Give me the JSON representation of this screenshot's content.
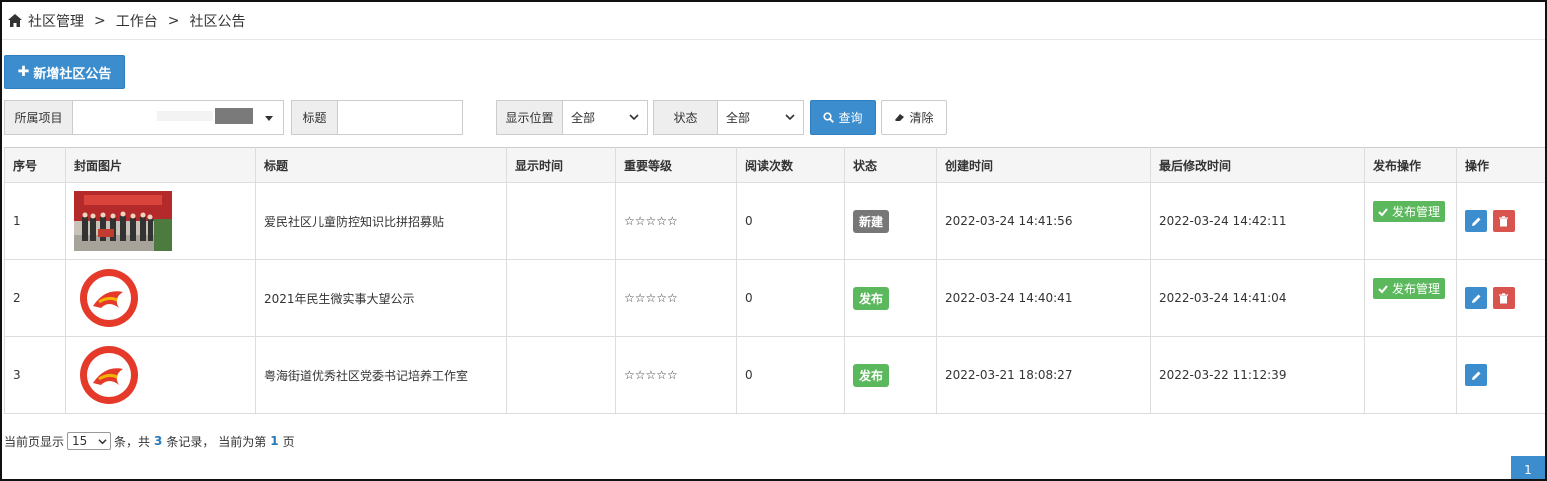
{
  "breadcrumb": {
    "items": [
      "社区管理",
      "工作台",
      "社区公告"
    ],
    "separator": ">"
  },
  "toolbar": {
    "add_label": "新增社区公告"
  },
  "filters": {
    "project_label": "所属项目",
    "title_label": "标题",
    "title_value": "",
    "display_label": "显示位置",
    "display_value": "全部",
    "status_label": "状态",
    "status_value": "全部",
    "query_label": "查询",
    "clear_label": "清除"
  },
  "table": {
    "headers": [
      "序号",
      "封面图片",
      "标题",
      "显示时间",
      "重要等级",
      "阅读次数",
      "状态",
      "创建时间",
      "最后修改时间",
      "发布操作",
      "操作"
    ],
    "rows": [
      {
        "index": "1",
        "cover": "photo",
        "title": "爱民社区儿童防控知识比拼招募贴",
        "display_time": "",
        "importance": "☆☆☆☆☆",
        "reads": "0",
        "status": "新建",
        "status_color": "#777777",
        "created": "2022-03-24 14:41:56",
        "modified": "2022-03-24 14:42:11",
        "publish_label": "发布管理",
        "has_publish": true,
        "has_delete": true
      },
      {
        "index": "2",
        "cover": "logo",
        "title": "2021年民生微实事大望公示",
        "display_time": "",
        "importance": "☆☆☆☆☆",
        "reads": "0",
        "status": "发布",
        "status_color": "#5cb85c",
        "created": "2022-03-24 14:40:41",
        "modified": "2022-03-24 14:41:04",
        "publish_label": "发布管理",
        "has_publish": true,
        "has_delete": true
      },
      {
        "index": "3",
        "cover": "logo",
        "title": "粤海街道优秀社区党委书记培养工作室",
        "display_time": "",
        "importance": "☆☆☆☆☆",
        "reads": "0",
        "status": "发布",
        "status_color": "#5cb85c",
        "created": "2022-03-21 18:08:27",
        "modified": "2022-03-22 11:12:39",
        "publish_label": "",
        "has_publish": false,
        "has_delete": false
      }
    ]
  },
  "pager": {
    "prefix": "当前页显示",
    "page_size": "15",
    "mid1": "条，共",
    "total": "3",
    "mid2": "条记录，  当前为第",
    "current": "1",
    "suffix": "页",
    "page_button": "1"
  },
  "colors": {
    "primary": "#3c8dcd",
    "success": "#5cb85c",
    "danger": "#d9534f",
    "neutral": "#777777"
  }
}
